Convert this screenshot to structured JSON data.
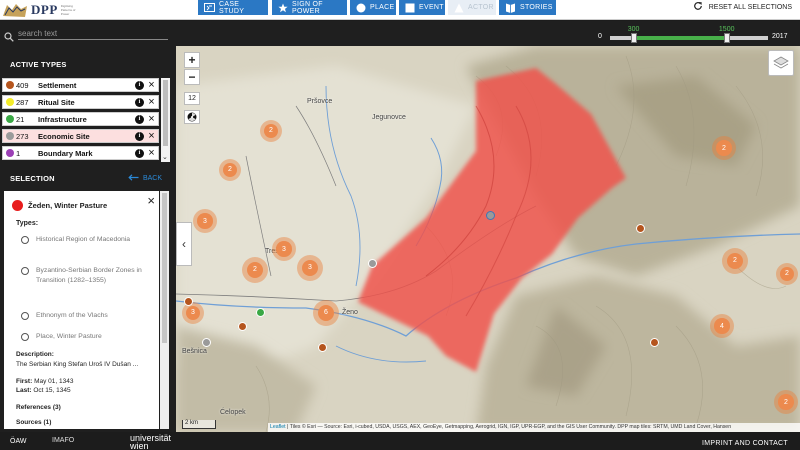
{
  "brand": {
    "short": "DPP",
    "subtitle": "Digitising Patterns of Power"
  },
  "nav": {
    "case_study": "CASE STUDY",
    "sign_of_power": "SIGN OF POWER",
    "place": "PLACE",
    "event": "EVENT",
    "actor": "ACTOR",
    "stories": "STORIES",
    "reset": "RESET ALL SELECTIONS"
  },
  "search": {
    "placeholder": "search text"
  },
  "timeline": {
    "min": "0",
    "max": "2017",
    "from": "300",
    "to": "1500",
    "from_fraction": 0.15,
    "to_fraction": 0.74
  },
  "active_types": {
    "title": "ACTIVE TYPES",
    "items": [
      {
        "count": "409",
        "name": "Settlement",
        "color": "#b5551e",
        "highlighted": false
      },
      {
        "count": "287",
        "name": "Ritual Site",
        "color": "#f4ec2a",
        "highlighted": false
      },
      {
        "count": "21",
        "name": "Infrastructure",
        "color": "#3aa845",
        "highlighted": false
      },
      {
        "count": "273",
        "name": "Economic Site",
        "color": "#9a9a9a",
        "highlighted": true
      },
      {
        "count": "1",
        "name": "Boundary Mark",
        "color": "#9b3fb5",
        "highlighted": false
      }
    ]
  },
  "selection": {
    "title": "SELECTION",
    "back": "BACK",
    "name": "Žeden, Winter Pasture",
    "types_label": "Types:",
    "types": [
      "Historical Region of Macedonia",
      "Byzantino-Serbian Border Zones in Transition (1282–1355)",
      "Ethnonym of the Vlachs",
      "Place, Winter Pasture"
    ],
    "description_label": "Description:",
    "description": "The Serbian King Stefan Uroš IV Dušan ...",
    "first_label": "First:",
    "first": "May 01, 1343",
    "last_label": "Last:",
    "last": "Oct 15, 1345",
    "references": "References (3)",
    "sources": "Sources (1)"
  },
  "map": {
    "zoom": "12",
    "zoom_in": "+",
    "zoom_out": "−",
    "scale": "2 km",
    "attribution_leaflet": "Leaflet",
    "attribution": " | Tiles © Esri — Source: Esri, i-cubed, USDA, USGS, AEX, GeoEye, Getmapping, Aerogrid, IGN, IGP, UPR-EGP, and the GIS User Community. DPP map tiles: SRTM, UMD Land Cover, Hansen",
    "places": [
      "Pršovce",
      "Jegunovce",
      "Treš",
      "Ženo",
      "Ćelopek",
      "Bešnica"
    ],
    "clusters": [
      "2",
      "2",
      "3",
      "3",
      "3",
      "2",
      "3",
      "6",
      "2",
      "2",
      "4",
      "2",
      "2"
    ]
  },
  "footer": {
    "oaw": "ÖAW",
    "imafo": "IMAFO",
    "uni": "universität wien",
    "imprint": "IMPRINT AND CONTACT"
  }
}
